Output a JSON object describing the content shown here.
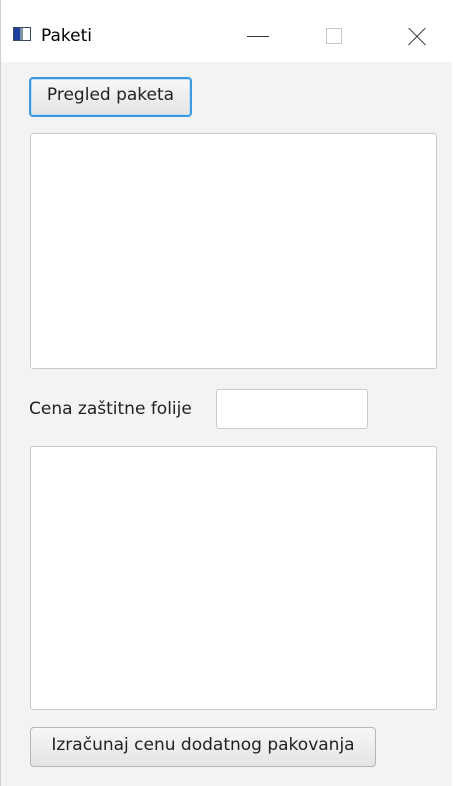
{
  "window": {
    "title": "Paketi",
    "icon": "java-app-icon",
    "controls": {
      "minimize": "minimize-icon",
      "maximize": "maximize-icon",
      "close": "close-icon"
    }
  },
  "main": {
    "review_button_label": "Pregled paketa",
    "packages_area_value": "",
    "foil_price_label": "Cena zaštitne folije",
    "foil_price_value": "",
    "result_area_value": "",
    "calculate_button_label": "Izračunaj cenu dodatnog pakovanja"
  }
}
